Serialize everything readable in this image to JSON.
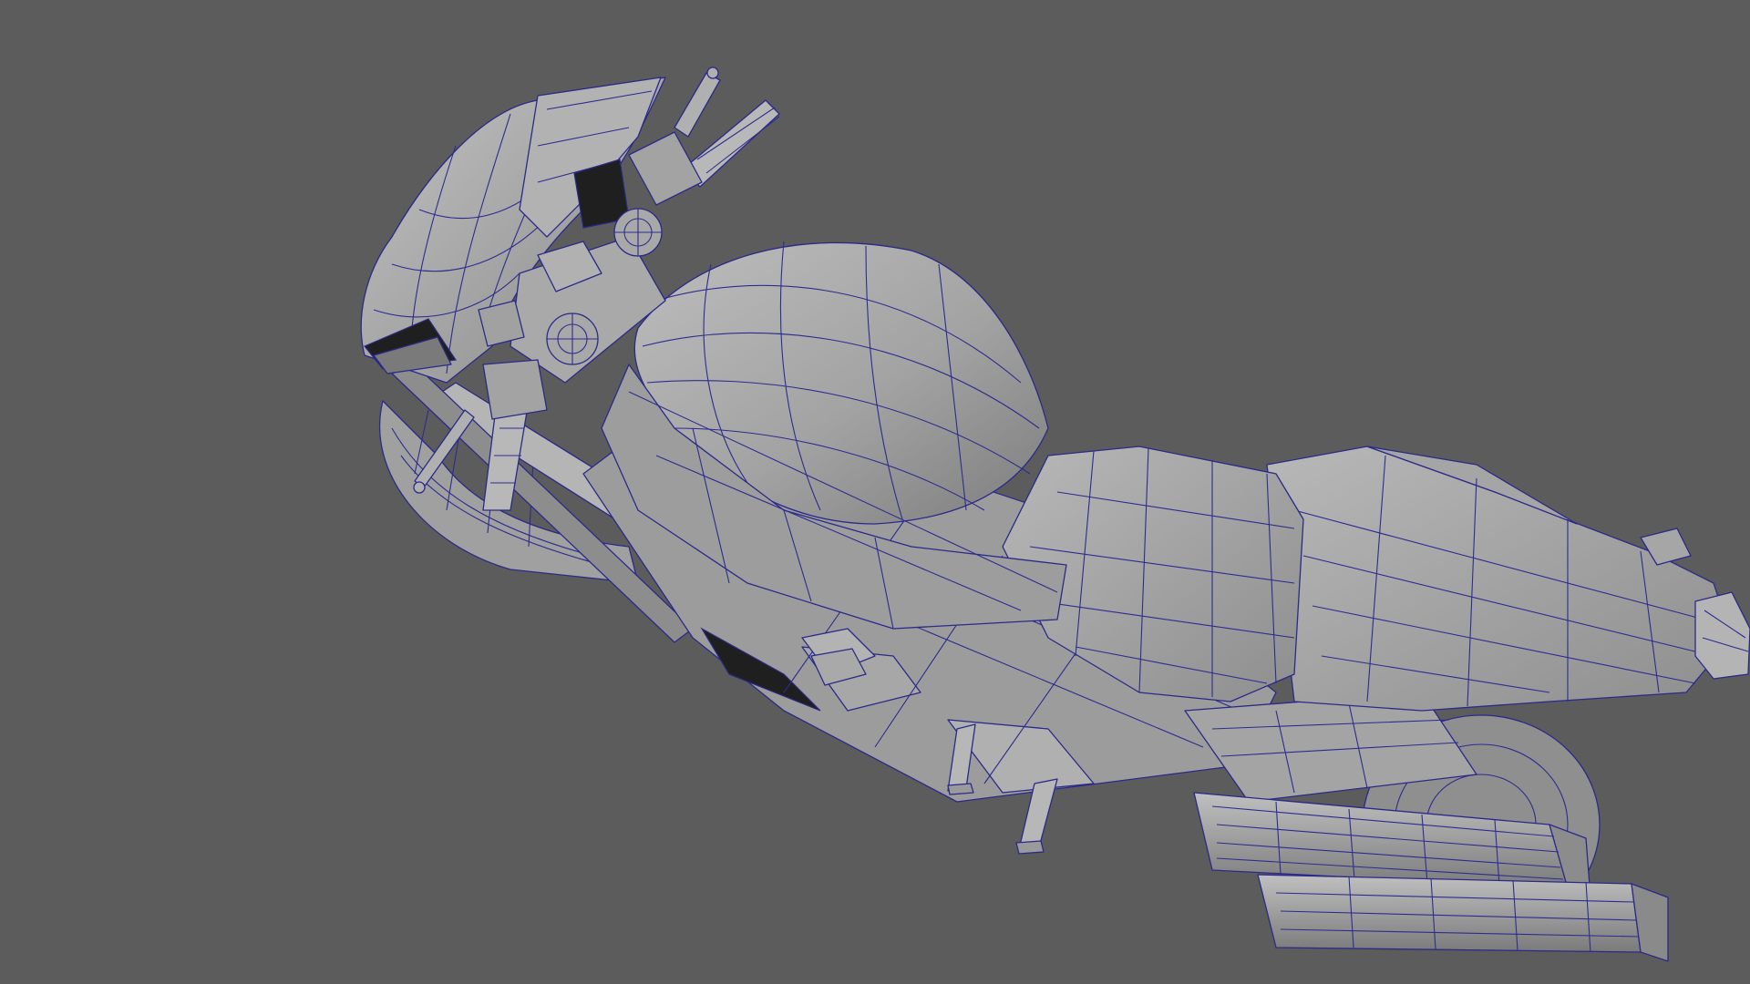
{
  "viewport": {
    "background_color": "#5c5c5c",
    "mesh_fill_color": "#a9a9a9",
    "mesh_shade_color": "#7c7c7c",
    "mesh_light_color": "#c4c4c4",
    "wireframe_color": "#2a2a8a",
    "model_name": "motorcycle-mesh"
  }
}
